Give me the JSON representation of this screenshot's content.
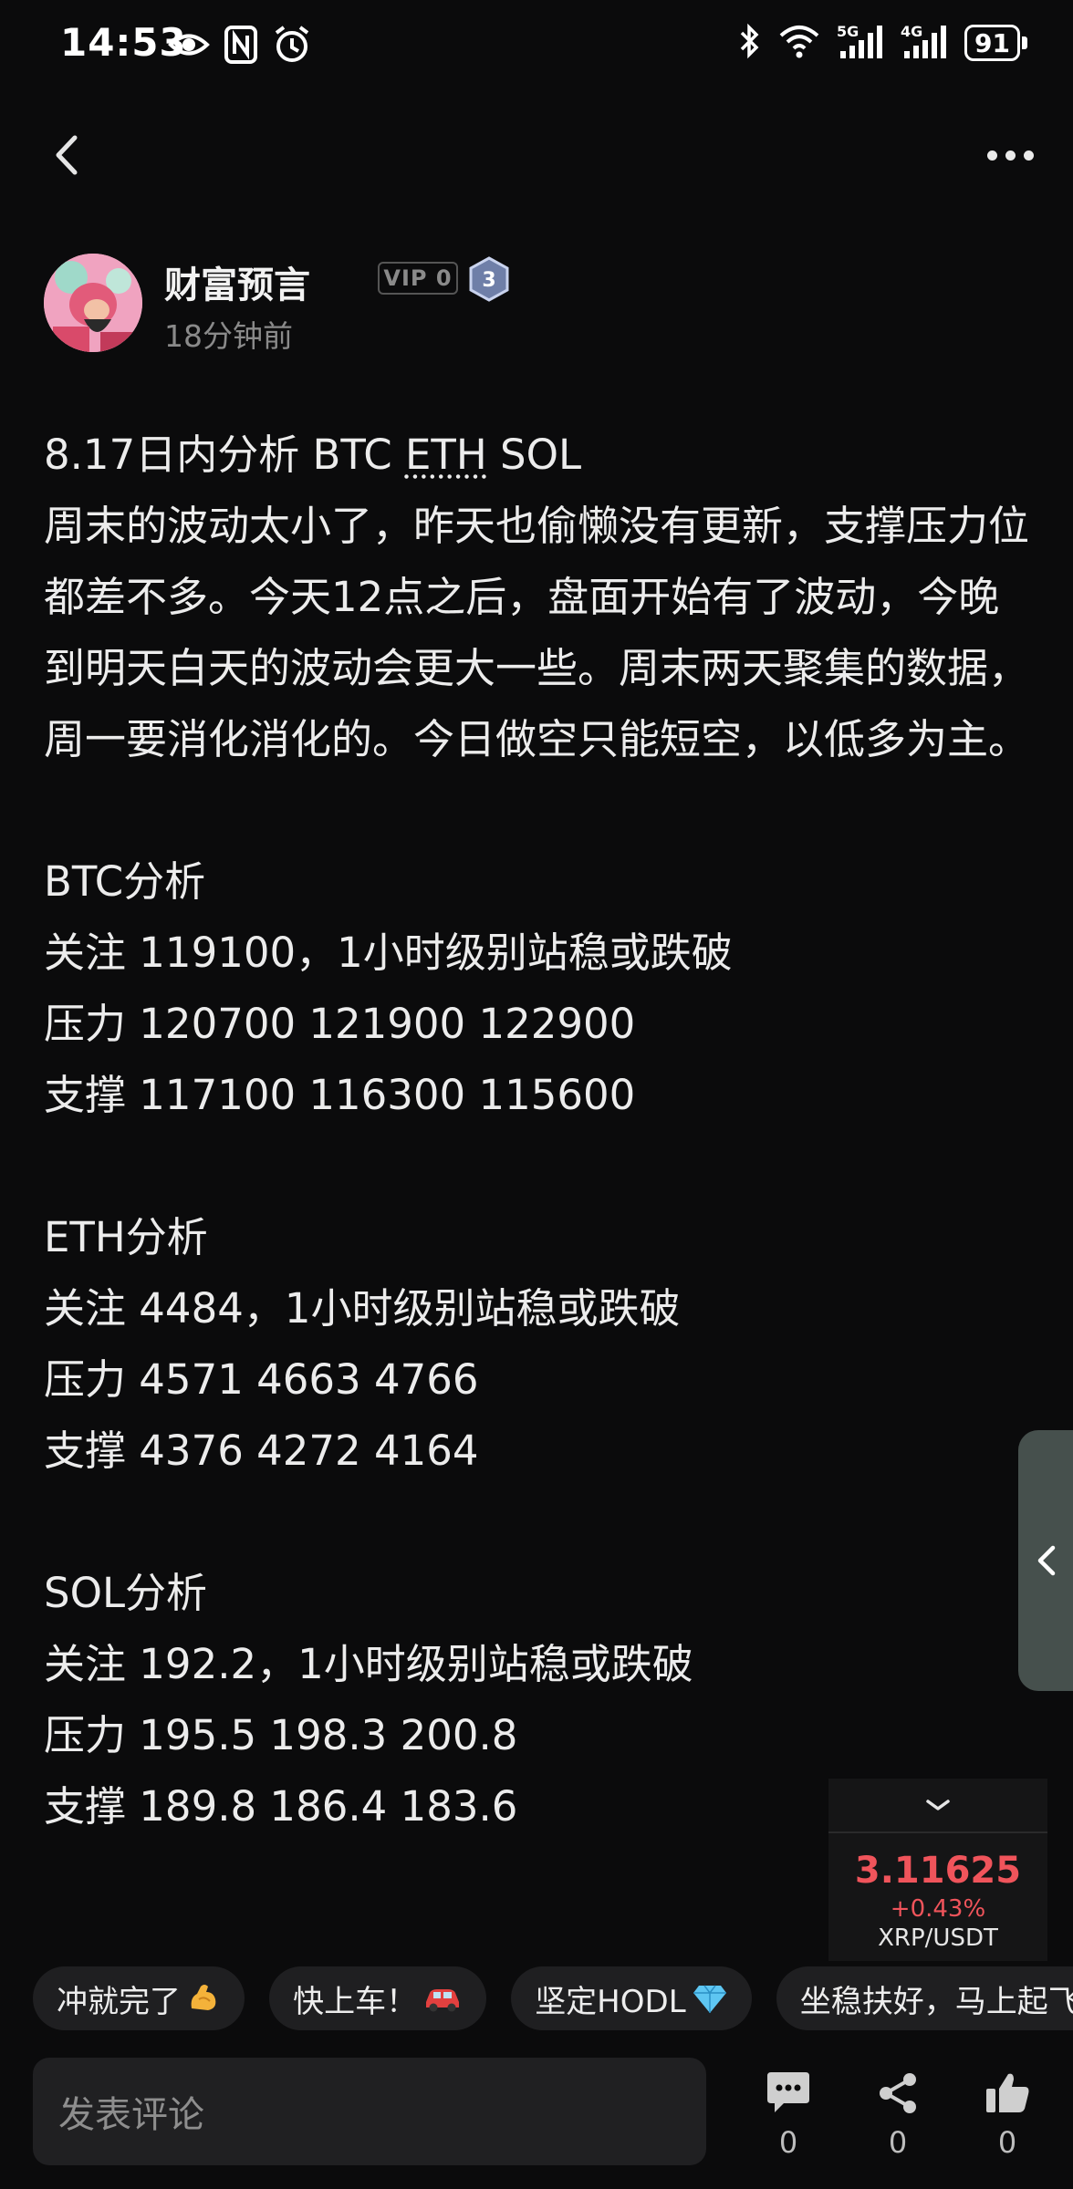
{
  "status_bar": {
    "time": "14:53",
    "battery": "91"
  },
  "author": {
    "name": "财富预言",
    "vip_label": "VIP 0",
    "level": "3",
    "time_ago": "18分钟前"
  },
  "post": {
    "title_prefix": "8.17日内分析 BTC ",
    "title_eth": "ETH",
    "title_suffix": " SOL",
    "intro": "周末的波动太小了，昨天也偷懒没有更新，支撑压力位都差不多。今天12点之后，盘面开始有了波动，今晚到明天白天的波动会更大一些。周末两天聚集的数据，周一要消化消化的。今日做空只能短空，以低多为主。",
    "sections": [
      {
        "heading": "BTC分析",
        "watch": "关注 119100，1小时级别站稳或跌破",
        "resistance": "压力 120700 121900 122900",
        "support": "支撑 117100 116300 115600"
      },
      {
        "heading": "ETH分析",
        "watch": "关注 4484，1小时级别站稳或跌破",
        "resistance": "压力 4571 4663 4766",
        "support": "支撑 4376 4272 4164"
      },
      {
        "heading": "SOL分析",
        "watch": "关注 192.2，1小时级别站稳或跌破",
        "resistance": "压力 195.5 198.3 200.8",
        "support": "支撑 189.8 186.4 183.6"
      }
    ]
  },
  "price_widget": {
    "price": "3.11625",
    "change": "+0.43%",
    "pair": "XRP/USDT",
    "color": "#f0545b"
  },
  "chips": [
    {
      "label": "冲就完了",
      "icon": "flexed-biceps-icon"
    },
    {
      "label": "快上车！",
      "icon": "car-icon"
    },
    {
      "label": "坚定HODL",
      "icon": "diamond-icon"
    },
    {
      "label": "坐稳扶好，马上起飞",
      "icon": ""
    }
  ],
  "bottom_bar": {
    "placeholder": "发表评论",
    "comment_count": "0",
    "share_count": "0",
    "like_count": "0"
  }
}
